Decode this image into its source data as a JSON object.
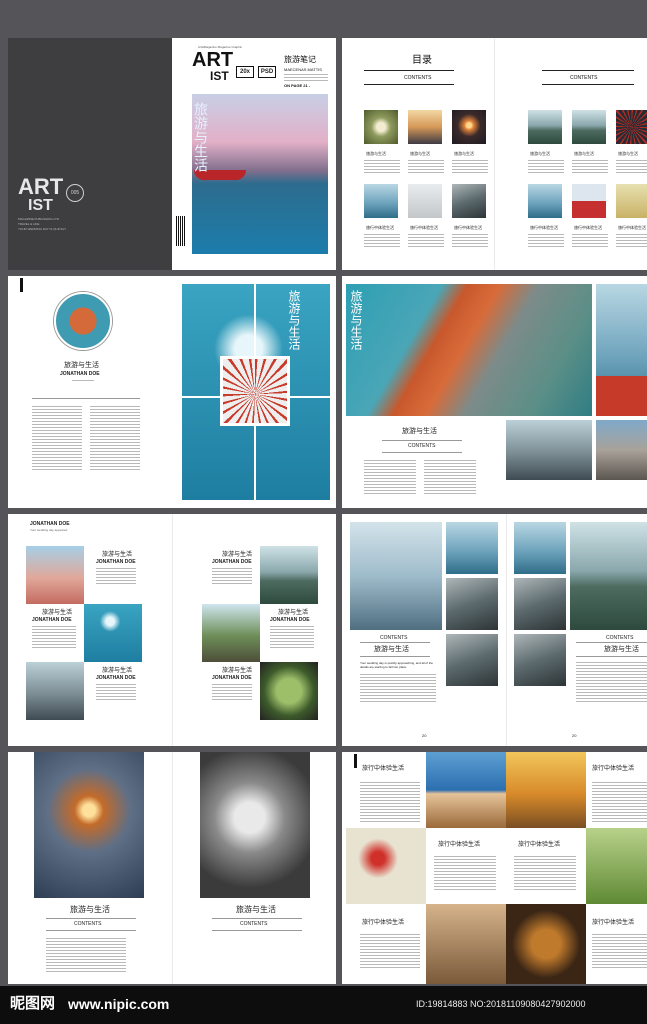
{
  "spread1": {
    "left": {
      "logo_line1": "ART",
      "logo_line2": "IST",
      "badge": "005",
      "sub_line1": "MAGAZINE PUBLISHING LTD",
      "sub_line2": "TRAVEL & LIFE",
      "sub_line3": "YOUR WEDDING DAY IS QUICKLY"
    },
    "right": {
      "masthead_tag": "Art&Magazine Magazine Graphic",
      "logo_line1": "ART",
      "logo_line2": "IST",
      "badge1": "20x",
      "badge2": "PSD",
      "cn_title": "旅游笔记",
      "en_name": "MAECENAS MATTIS",
      "page_ref": "ON PAGE 21 -",
      "vertical_title": "旅游与生活"
    }
  },
  "spread2": {
    "heading_cn": "目录",
    "left_label": "CONTENTS",
    "right_label": "CONTENTS",
    "caption": "旅游与生活",
    "caption_bottom": "旅行中体验生活"
  },
  "spread3": {
    "left_title": "旅游与生活",
    "left_name": "JONATHAN DOE",
    "photo_title": "旅游与生活",
    "right_photo_title": "旅游与生活",
    "right_title": "旅游与生活",
    "right_label": "CONTENTS"
  },
  "spread4": {
    "top_name": "JONATHAN DOE",
    "top_sub": "Your wedding day appeared",
    "blocks": [
      {
        "title": "旅游与生活",
        "name": "JONATHAN DOE"
      },
      {
        "title": "旅游与生活",
        "name": "JONATHAN DOE"
      },
      {
        "title": "旅游与生活",
        "name": "JONATHAN DOE"
      },
      {
        "title": "旅游与生活",
        "name": "JONATHAN DOE"
      },
      {
        "title": "旅游与生活",
        "name": "JONATHAN DOE"
      },
      {
        "title": "旅游与生活",
        "name": "JONATHAN DOE"
      }
    ],
    "right_label1": "CONTENTS",
    "right_title1": "旅游与生活",
    "right_label2": "CONTENTS",
    "right_title2": "旅游与生活",
    "folio_left": "20",
    "folio_right": "20",
    "body_text": "Your wedding day is quickly approaching, and all of the details are starting to fall into place."
  },
  "spread5": {
    "left_title": "旅游与生活",
    "left_label": "CONTENTS",
    "right_title": "旅游与生活",
    "right_label": "CONTENTS",
    "r_titles": [
      "旅行中体验生活",
      "旅行中体验生活",
      "旅行中体验生活",
      "旅行中体验生活",
      "旅行中体验生活",
      "旅行中体验生活"
    ]
  },
  "watermark": {
    "brand": "昵图网",
    "url": "www.nipic.com",
    "id_text": "ID:19814883 NO:20181109080427902000"
  }
}
